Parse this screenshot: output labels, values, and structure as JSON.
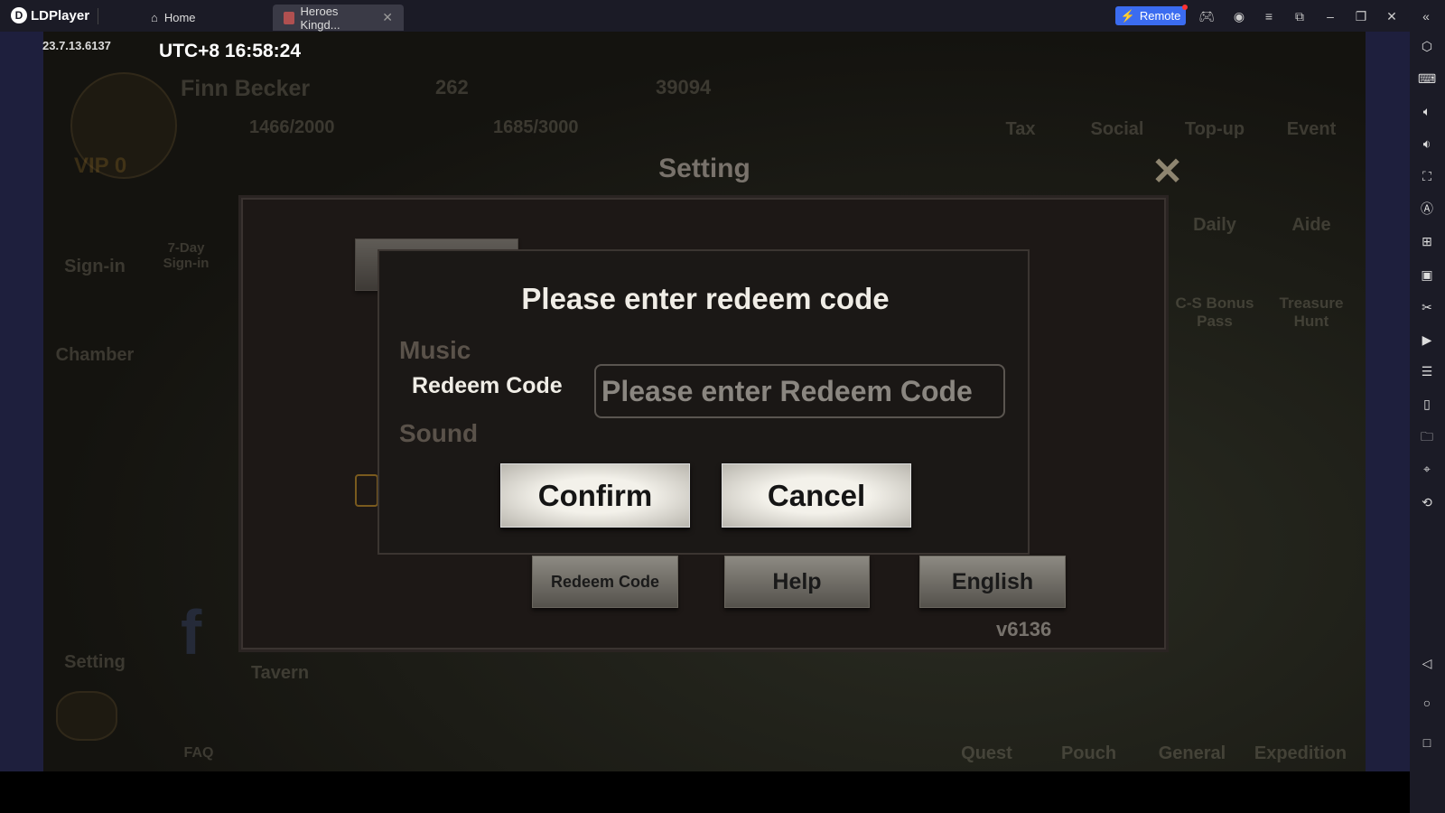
{
  "app": {
    "name": "LDPlayer",
    "tabs": [
      {
        "label": "Home",
        "icon": "home-icon"
      },
      {
        "label": "Heroes Kingd...",
        "icon": "game-icon"
      }
    ],
    "remote_label": "Remote",
    "accent": "#3b6cf0"
  },
  "hud": {
    "version": "23.7.13.6137",
    "clock": "UTC+8 16:58:24",
    "player": "Finn Becker",
    "gold": "262",
    "silver": "39094",
    "stamina": "1466/2000",
    "health": "1685/3000",
    "vip": "VIP 0"
  },
  "menu": {
    "top": [
      "Tax",
      "Social",
      "Top-up",
      "Event"
    ],
    "right": [
      "Daily",
      "Aide",
      "C-S Bonus Pass",
      "Treasure Hunt"
    ],
    "left": [
      "Sign-in",
      "7-Day Sign-in",
      "Chamber",
      "Setting",
      "Tavern",
      "FAQ"
    ],
    "bottom": [
      "Quest",
      "Pouch",
      "General",
      "Expedition"
    ]
  },
  "setting": {
    "title": "Setting",
    "music": "Music",
    "sound": "Sound",
    "buttons": {
      "redeem": "Redeem Code",
      "help": "Help",
      "language": "English"
    },
    "version": "v6136"
  },
  "dialog": {
    "title": "Please enter redeem code",
    "label": "Redeem Code",
    "input_value": "",
    "placeholder": "Please enter Redeem Code",
    "confirm": "Confirm",
    "cancel": "Cancel"
  }
}
